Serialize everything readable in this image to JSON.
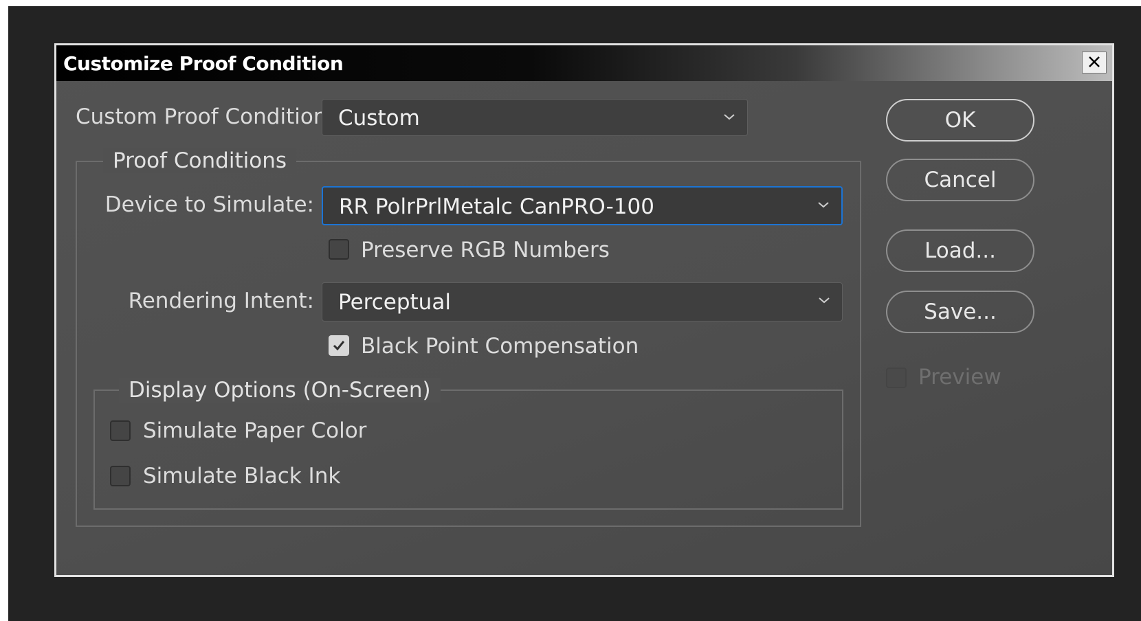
{
  "window": {
    "title": "Customize Proof Condition",
    "close_label": "✕"
  },
  "custom_proof_condition": {
    "label": "Custom Proof Condition:",
    "value": "Custom"
  },
  "proof_conditions": {
    "legend": "Proof Conditions",
    "device_label": "Device to Simulate:",
    "device_value": "RR PolrPrlMetalc CanPRO-100",
    "preserve_rgb": {
      "label": "Preserve RGB Numbers",
      "checked": false
    },
    "rendering_label": "Rendering Intent:",
    "rendering_value": "Perceptual",
    "black_point": {
      "label": "Black Point Compensation",
      "checked": true
    }
  },
  "display_options": {
    "legend": "Display Options (On-Screen)",
    "paper_color": {
      "label": "Simulate Paper Color",
      "checked": false
    },
    "black_ink": {
      "label": "Simulate Black Ink",
      "checked": false
    }
  },
  "buttons": {
    "ok": "OK",
    "cancel": "Cancel",
    "load": "Load...",
    "save": "Save..."
  },
  "preview": {
    "label": "Preview",
    "checked": false,
    "enabled": false
  },
  "colors": {
    "focus_border": "#1c74d4",
    "dialog_bg": "#515151",
    "backdrop": "#232323"
  }
}
